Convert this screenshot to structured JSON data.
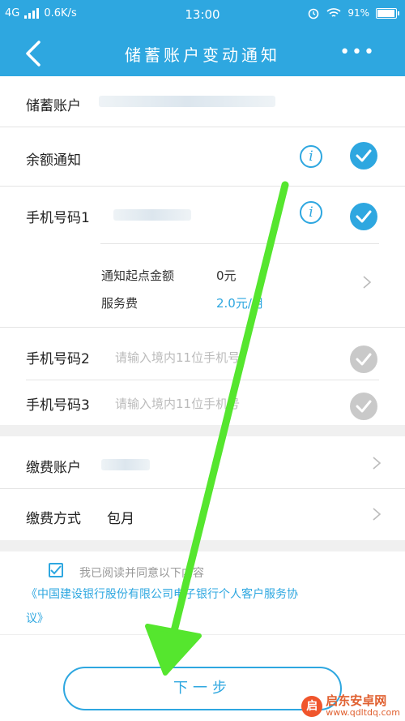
{
  "status_bar": {
    "network": "4G",
    "speed": "0.6K/s",
    "time": "13:00",
    "battery": "91%"
  },
  "header": {
    "title": "储蓄账户变动通知",
    "more": "•••"
  },
  "account": {
    "label": "储蓄账户"
  },
  "balance_notice": {
    "label": "余额通知"
  },
  "phone1": {
    "label": "手机号码1",
    "threshold_label": "通知起点金额",
    "threshold_value": "0元",
    "fee_label": "服务费",
    "fee_value": "2.0元/月"
  },
  "phone2": {
    "label": "手机号码2",
    "placeholder": "请输入境内11位手机号"
  },
  "phone3": {
    "label": "手机号码3",
    "placeholder": "请输入境内11位手机号"
  },
  "payment_account": {
    "label": "缴费账户"
  },
  "payment_method": {
    "label": "缴费方式",
    "value": "包月"
  },
  "agreement": {
    "text": "我已阅读并同意以下内容",
    "link_line1": "《中国建设银行股份有限公司电子银行个人客户服务协",
    "link_line2": "议》"
  },
  "next_button": {
    "label": "下一步"
  },
  "watermark": {
    "logo": "启",
    "name": "启东安卓网",
    "url": "www.qdltdq.com"
  },
  "colors": {
    "brand": "#2ea7e0",
    "annotation_arrow": "#55e62e"
  }
}
